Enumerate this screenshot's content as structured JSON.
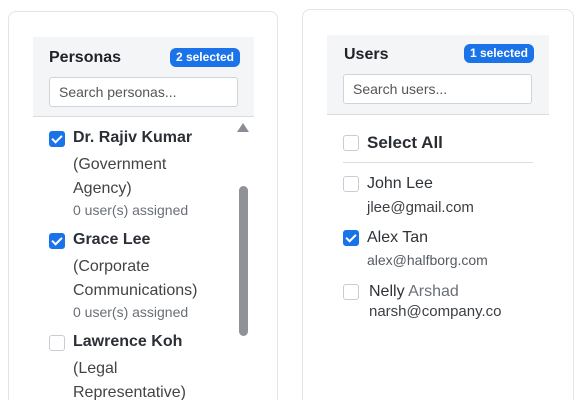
{
  "personas_panel": {
    "title": "Personas",
    "badge": "2 selected",
    "search_placeholder": "Search personas...",
    "items": [
      {
        "name": "Dr. Rajiv Kumar",
        "desc1": "(Government",
        "desc2": "Agency)",
        "count": "0 user(s) assigned",
        "checked": true
      },
      {
        "name": "Grace Lee",
        "desc1": "(Corporate",
        "desc2": "Communications)",
        "count": "0 user(s) assigned",
        "checked": true
      },
      {
        "name": "Lawrence Koh",
        "desc1": "(Legal",
        "desc2": "Representative)",
        "checked": false
      }
    ]
  },
  "users_panel": {
    "title": "Users",
    "badge": "1 selected",
    "search_placeholder": "Search users...",
    "select_all_label": "Select All",
    "items": [
      {
        "name": "John Lee",
        "email": "jlee@gmail.com",
        "checked": false
      },
      {
        "name": "Alex Tan",
        "email": "alex@halfborg.com",
        "checked": true
      },
      {
        "name_first": "Nelly",
        "name_last": "Arshad",
        "email": "narsh@company.co",
        "checked": false
      }
    ]
  },
  "colors": {
    "accent": "#1a73e8",
    "scrollbar": "#8f9398"
  }
}
